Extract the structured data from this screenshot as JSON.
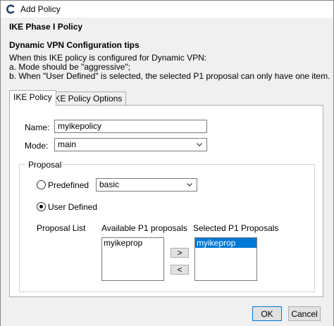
{
  "window": {
    "title": "Add Policy"
  },
  "header": {
    "section_title": "IKE Phase I Policy"
  },
  "tips": {
    "title": "Dynamic VPN Configuration tips",
    "line1": "When this IKE policy is configured for Dynamic VPN:",
    "line2": "a. Mode should be \"aggressive\";",
    "line3": "b. When \"User Defined\" is selected, the selected P1 proposal can  only have one item."
  },
  "tabs": [
    {
      "label": "IKE Policy",
      "active": true
    },
    {
      "label": "IKE Policy Options",
      "active": false
    }
  ],
  "form": {
    "name_label": "Name:",
    "name_value": "myikepolicy",
    "mode_label": "Mode:",
    "mode_value": "main"
  },
  "proposal": {
    "legend": "Proposal",
    "predefined_label": "Predefined",
    "predefined_value": "basic",
    "predefined_selected": false,
    "user_defined_label": "User Defined",
    "user_defined_selected": true,
    "list_label": "Proposal List",
    "available_label": "Available P1 proposals",
    "selected_label": "Selected P1 Proposals",
    "available_items": [
      "myikeprop"
    ],
    "selected_items": [
      "myikeprop"
    ],
    "add_button": ">",
    "remove_button": "<"
  },
  "footer": {
    "ok_label": "OK",
    "cancel_label": "Cancel"
  },
  "colors": {
    "selection": "#0078d7",
    "accent": "#0078d7"
  }
}
